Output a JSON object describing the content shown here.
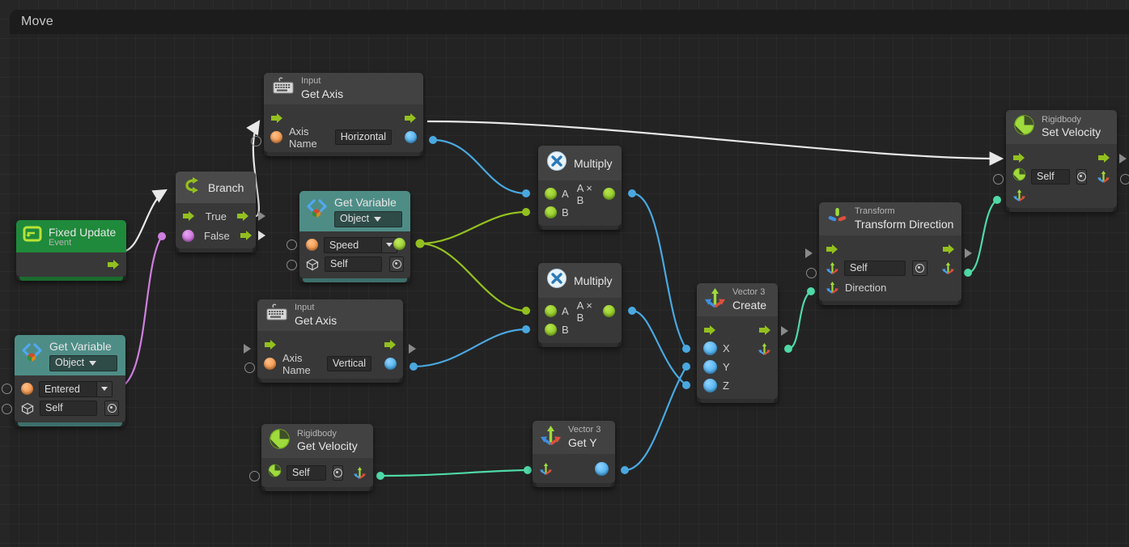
{
  "panel": {
    "title": "Move"
  },
  "nodes": {
    "fixed_update": {
      "title": "Fixed Update",
      "subtitle": "Event",
      "icon": "event-loop-icon"
    },
    "get_variable_entered": {
      "title": "Get Variable",
      "scope": "Object",
      "icon": "code-brackets-icon",
      "variable": "Entered",
      "source": "Self"
    },
    "branch": {
      "title": "Branch",
      "icon": "branch-icon",
      "true_label": "True",
      "false_label": "False"
    },
    "get_variable_speed": {
      "title": "Get Variable",
      "scope": "Object",
      "icon": "code-brackets-icon",
      "variable": "Speed",
      "source": "Self"
    },
    "input_get_axis_horizontal": {
      "subtitle": "Input",
      "title": "Get Axis",
      "icon": "keyboard-icon",
      "port_label": "Axis Name",
      "axis_value": "Horizontal"
    },
    "input_get_axis_vertical": {
      "subtitle": "Input",
      "title": "Get Axis",
      "icon": "keyboard-icon",
      "port_label": "Axis Name",
      "axis_value": "Vertical"
    },
    "multiply_top": {
      "title": "Multiply",
      "icon": "multiply-icon",
      "a": "A",
      "b": "B",
      "result": "A × B"
    },
    "multiply_bottom": {
      "title": "Multiply",
      "icon": "multiply-icon",
      "a": "A",
      "b": "B",
      "result": "A × B"
    },
    "rigidbody_get_velocity": {
      "subtitle": "Rigidbody",
      "title": "Get Velocity",
      "icon": "rigidbody-icon",
      "target": "Self"
    },
    "vector3_get_y": {
      "subtitle": "Vector 3",
      "title": "Get Y",
      "icon": "vector3-icon"
    },
    "vector3_create": {
      "subtitle": "Vector 3",
      "title": "Create",
      "icon": "vector3-icon",
      "x": "X",
      "y": "Y",
      "z": "Z"
    },
    "transform_direction": {
      "subtitle": "Transform",
      "title": "Transform Direction",
      "icon": "transform-icon",
      "target": "Self",
      "direction_label": "Direction"
    },
    "rigidbody_set_velocity": {
      "subtitle": "Rigidbody",
      "title": "Set Velocity",
      "icon": "rigidbody-icon",
      "target": "Self"
    }
  },
  "colors": {
    "flow_wire": "#e8e8e8",
    "bool_wire": "#cf7fe0",
    "float_wire": "#4aa8e0",
    "number_wire": "#93c01f",
    "vector_wire": "#4fd9a6",
    "node_body": "#383838",
    "node_header": "#424242",
    "event_green": "#1f8a3b",
    "variable_teal": "#4e8d86",
    "canvas": "#262626"
  }
}
